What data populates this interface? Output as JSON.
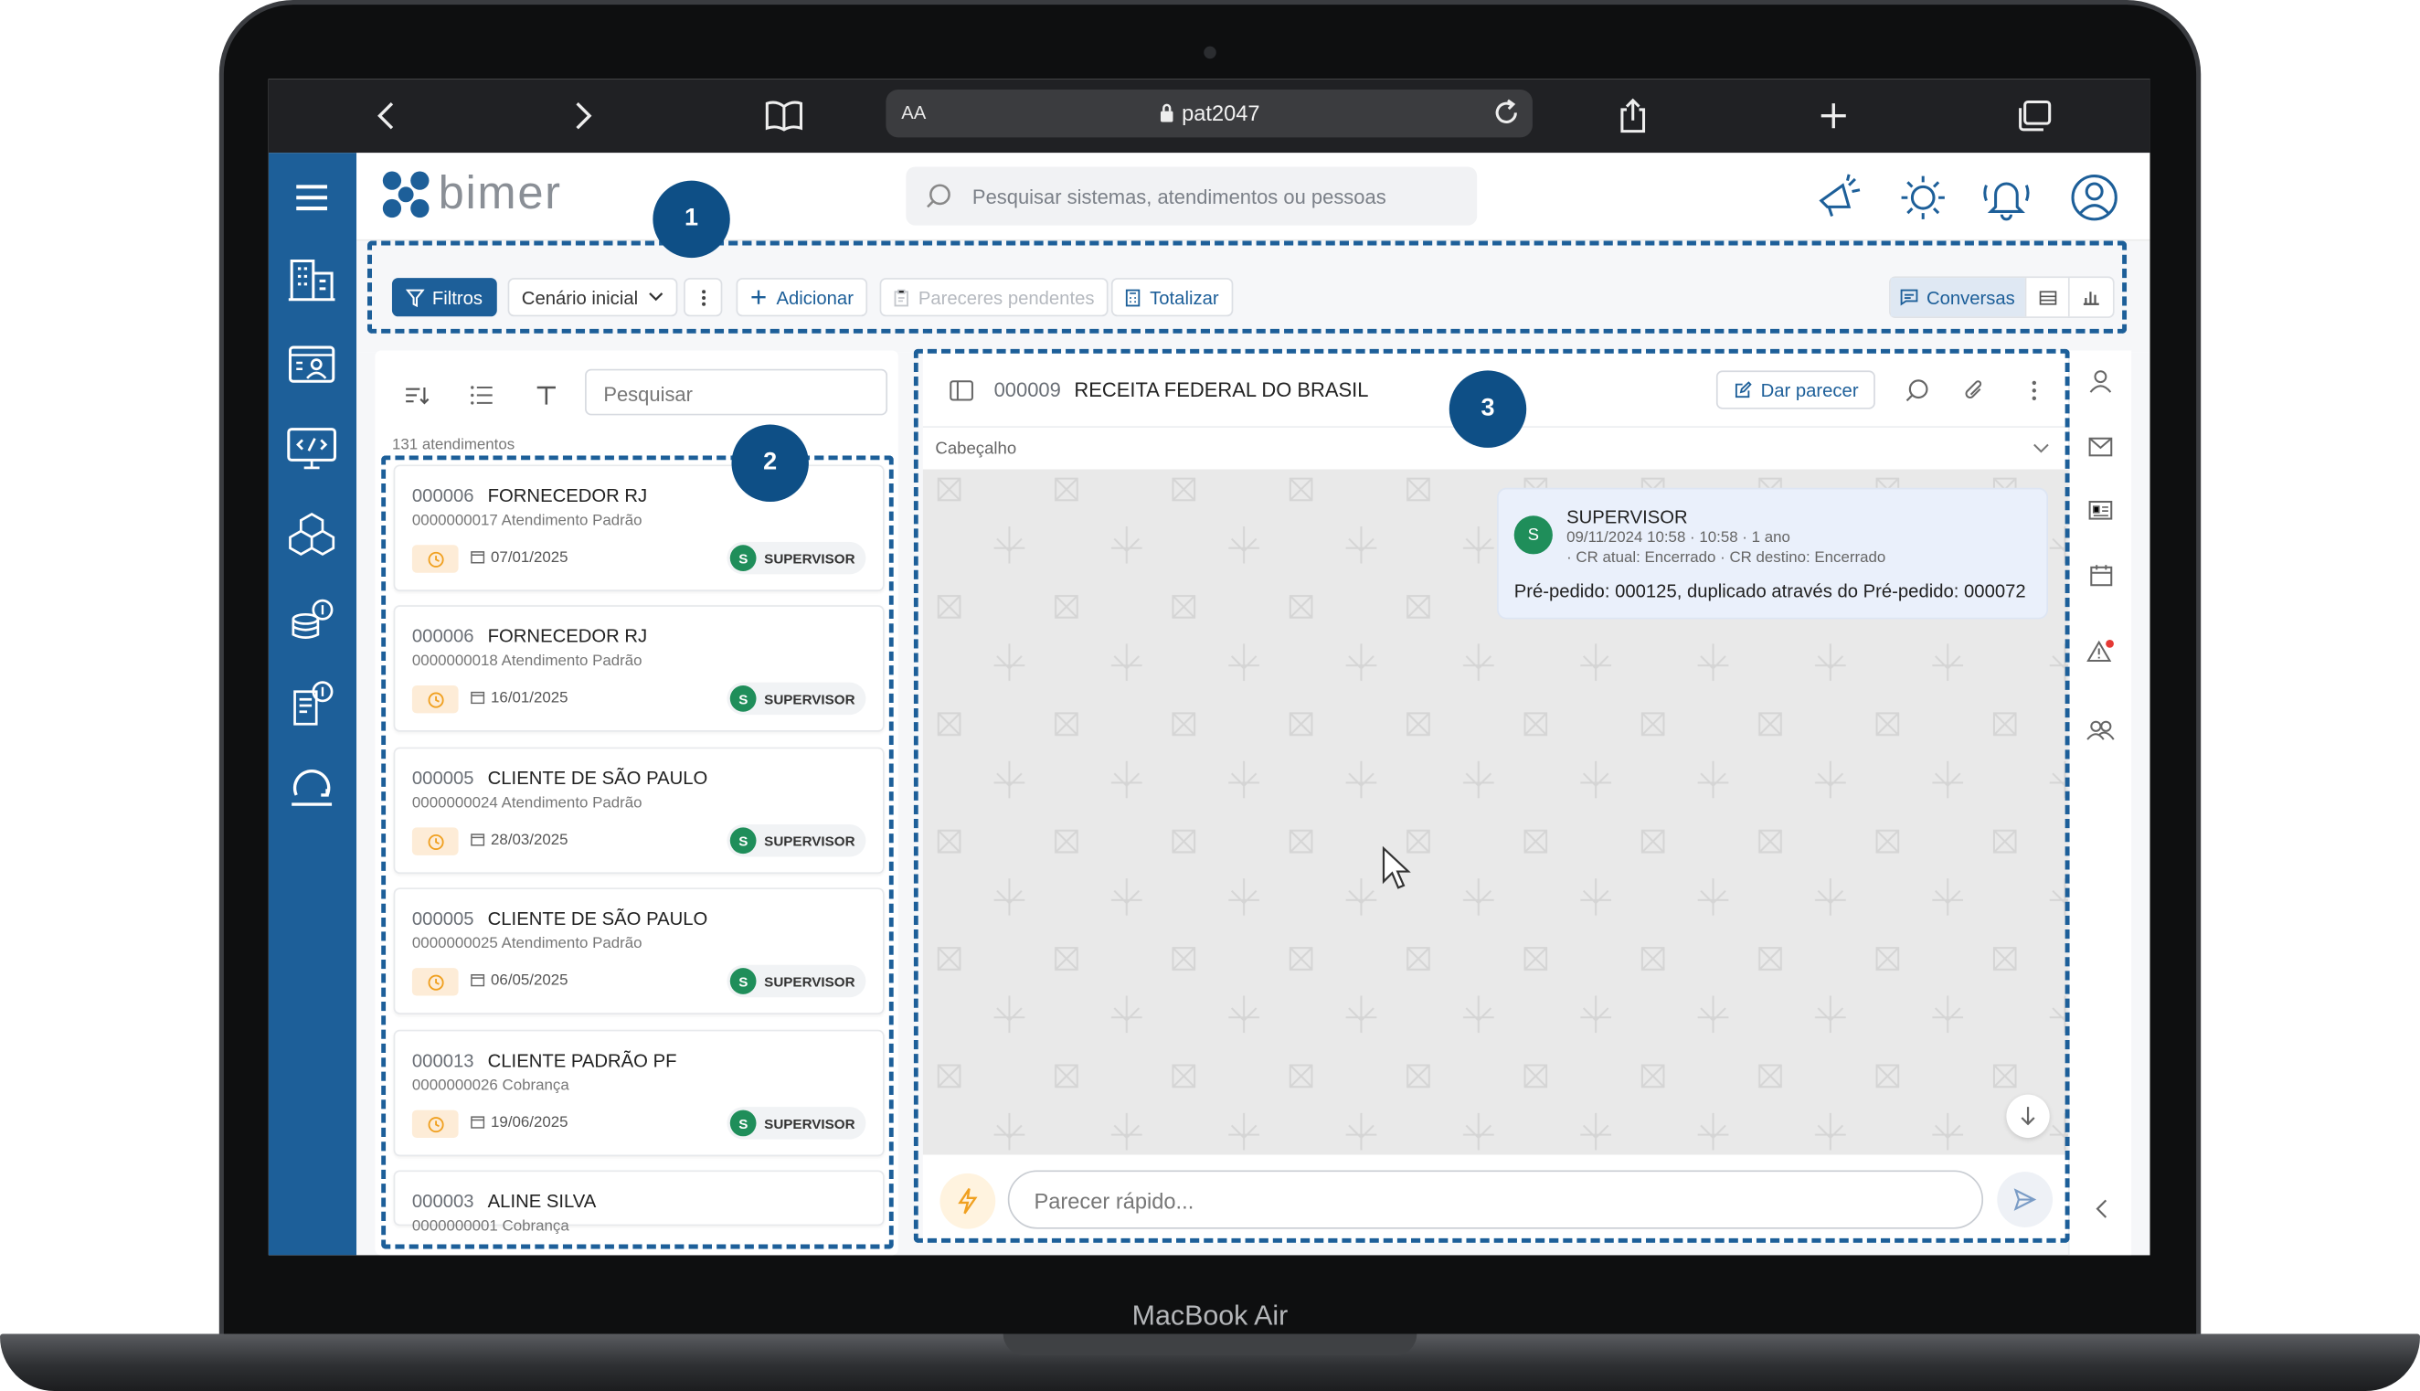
{
  "device": {
    "label": "MacBook Air"
  },
  "browser": {
    "text_size_label": "AA",
    "url": "pat2047"
  },
  "app": {
    "logo_text": "bimer",
    "search_placeholder": "Pesquisar sistemas, atendimentos ou pessoas"
  },
  "toolbar": {
    "filtros": "Filtros",
    "cenario": "Cenário inicial",
    "adicionar": "Adicionar",
    "pareceres": "Pareceres pendentes",
    "totalizar": "Totalizar",
    "conversas": "Conversas"
  },
  "list": {
    "search_placeholder": "Pesquisar",
    "count": "131 atendimentos",
    "items": [
      {
        "code": "000006",
        "name": "FORNECEDOR RJ",
        "sub": "0000000017 Atendimento Padrão",
        "date": "07/01/2025",
        "user": "SUPERVISOR",
        "initial": "S"
      },
      {
        "code": "000006",
        "name": "FORNECEDOR RJ",
        "sub": "0000000018 Atendimento Padrão",
        "date": "16/01/2025",
        "user": "SUPERVISOR",
        "initial": "S"
      },
      {
        "code": "000005",
        "name": "CLIENTE DE SÃO PAULO",
        "sub": "0000000024 Atendimento Padrão",
        "date": "28/03/2025",
        "user": "SUPERVISOR",
        "initial": "S"
      },
      {
        "code": "000005",
        "name": "CLIENTE DE SÃO PAULO",
        "sub": "0000000025 Atendimento Padrão",
        "date": "06/05/2025",
        "user": "SUPERVISOR",
        "initial": "S"
      },
      {
        "code": "000013",
        "name": "CLIENTE PADRÃO PF",
        "sub": "0000000026 Cobrança",
        "date": "19/06/2025",
        "user": "SUPERVISOR",
        "initial": "S"
      },
      {
        "code": "000003",
        "name": "ALINE SILVA",
        "sub": "0000000001 Cobrança",
        "date": "",
        "user": "",
        "initial": ""
      }
    ]
  },
  "conversation": {
    "code": "000009",
    "name": "RECEITA FEDERAL DO BRASIL",
    "dar_parecer": "Dar parecer",
    "section": "Cabeçalho",
    "message": {
      "initial": "S",
      "author": "SUPERVISOR",
      "time": "09/11/2024 10:58 · 10:58 · 1 ano",
      "cr": "· CR atual: Encerrado · CR destino: Encerrado",
      "text": "Pré-pedido: 000125, duplicado através do Pré-pedido: 000072"
    },
    "input_placeholder": "Parecer rápido..."
  },
  "annotations": {
    "one": "1",
    "two": "2",
    "three": "3"
  },
  "colors": {
    "brand": "#1d5f99",
    "badge": "#0e4f86",
    "avatar": "#1f8e5a",
    "warning_dot": "#e53935"
  }
}
